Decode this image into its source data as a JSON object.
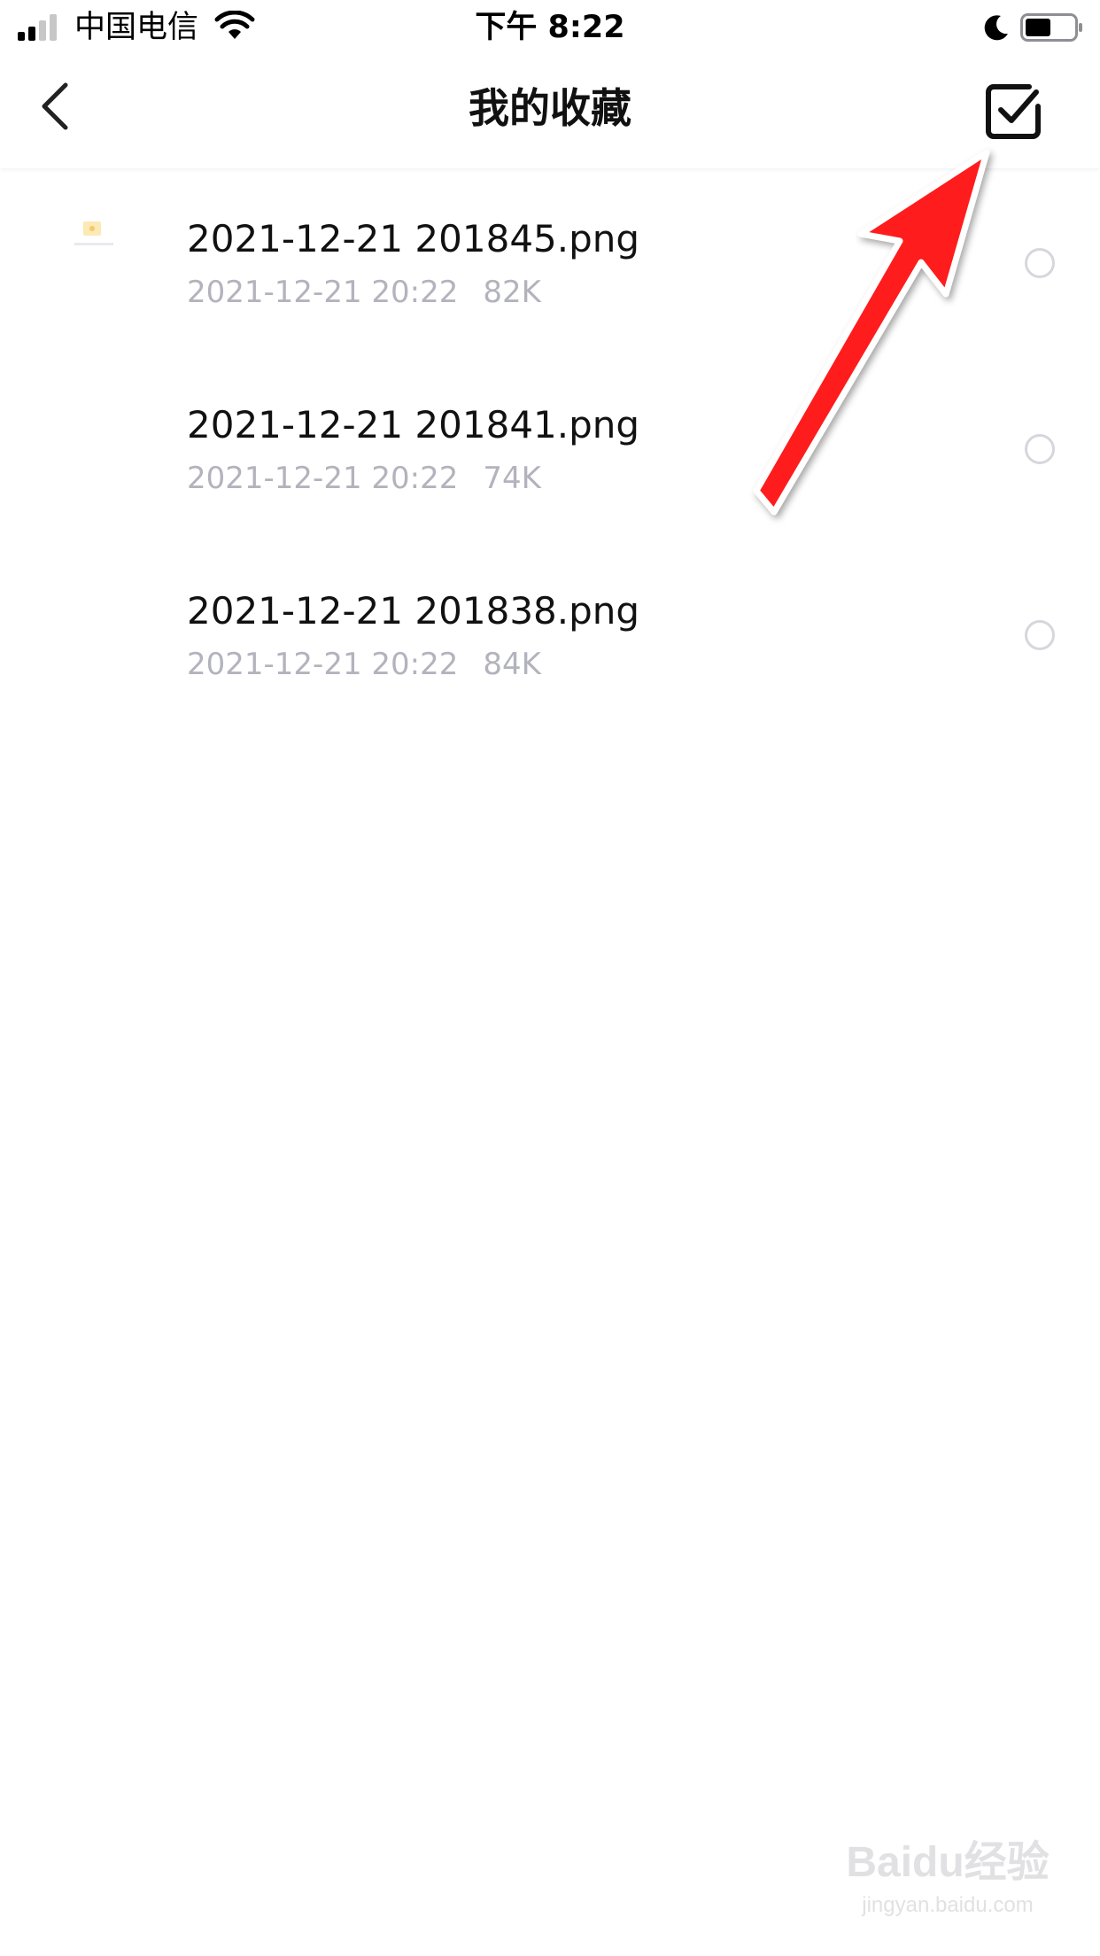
{
  "status_bar": {
    "carrier": "中国电信",
    "time": "下午 8:22",
    "signal_icon": "signal-bars-icon",
    "wifi_icon": "wifi-icon",
    "dnd_icon": "moon-icon",
    "battery_icon": "battery-icon"
  },
  "nav": {
    "title": "我的收藏",
    "back_icon": "chevron-left-icon",
    "select_icon": "checkbox-icon"
  },
  "files": [
    {
      "name": "2021-12-21 201845.png",
      "date": "2021-12-21 20:22",
      "size": "82K",
      "has_thumbnail": true,
      "selected": false
    },
    {
      "name": "2021-12-21 201841.png",
      "date": "2021-12-21 20:22",
      "size": "74K",
      "has_thumbnail": false,
      "selected": false
    },
    {
      "name": "2021-12-21 201838.png",
      "date": "2021-12-21 20:22",
      "size": "84K",
      "has_thumbnail": false,
      "selected": false
    }
  ],
  "watermark": {
    "brand": "Baidu经验",
    "url": "jingyan.baidu.com"
  },
  "colors": {
    "title": "#111111",
    "meta": "#b3b3bd",
    "radio_border": "#d6d6dc",
    "annotation_arrow": "#ff1a1a"
  }
}
